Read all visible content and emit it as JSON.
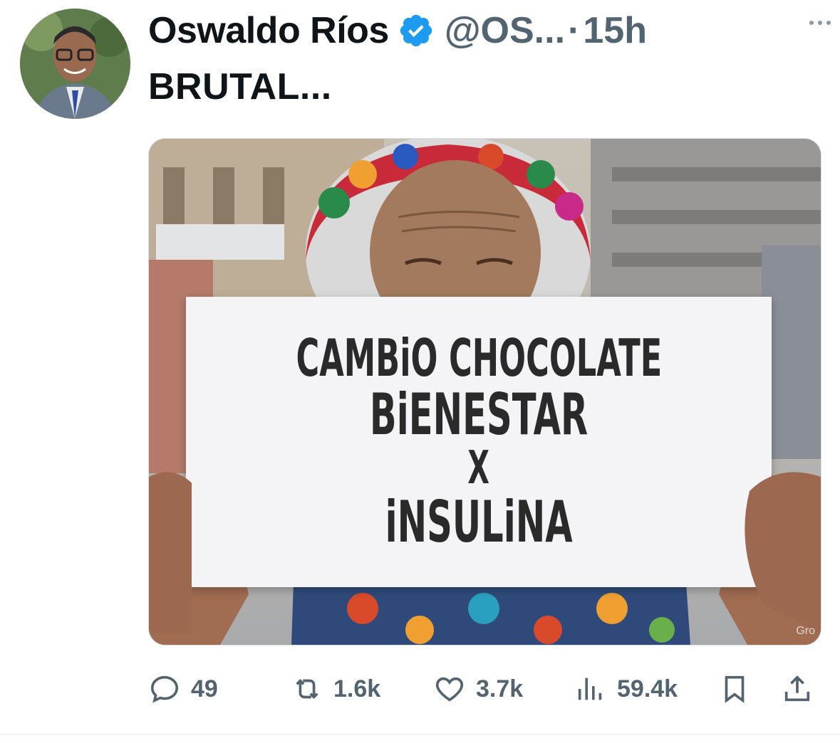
{
  "tweet": {
    "author_name": "Oswaldo Ríos",
    "handle": "@OS...",
    "separator": "·",
    "time": "15h",
    "text": "BRUTAL...",
    "verified_color": "#1d9bf0"
  },
  "media": {
    "sign_lines": [
      "CAMBiO CHOCOLATE",
      "BiENESTAR",
      "X",
      "iNSULiNA"
    ],
    "watermark": "Gro"
  },
  "actions": {
    "replies": "49",
    "retweets": "1.6k",
    "likes": "3.7k",
    "views": "59.4k"
  },
  "icons": [
    "more-icon",
    "verified-icon",
    "reply-icon",
    "retweet-icon",
    "like-icon",
    "views-icon",
    "bookmark-icon",
    "share-icon"
  ]
}
